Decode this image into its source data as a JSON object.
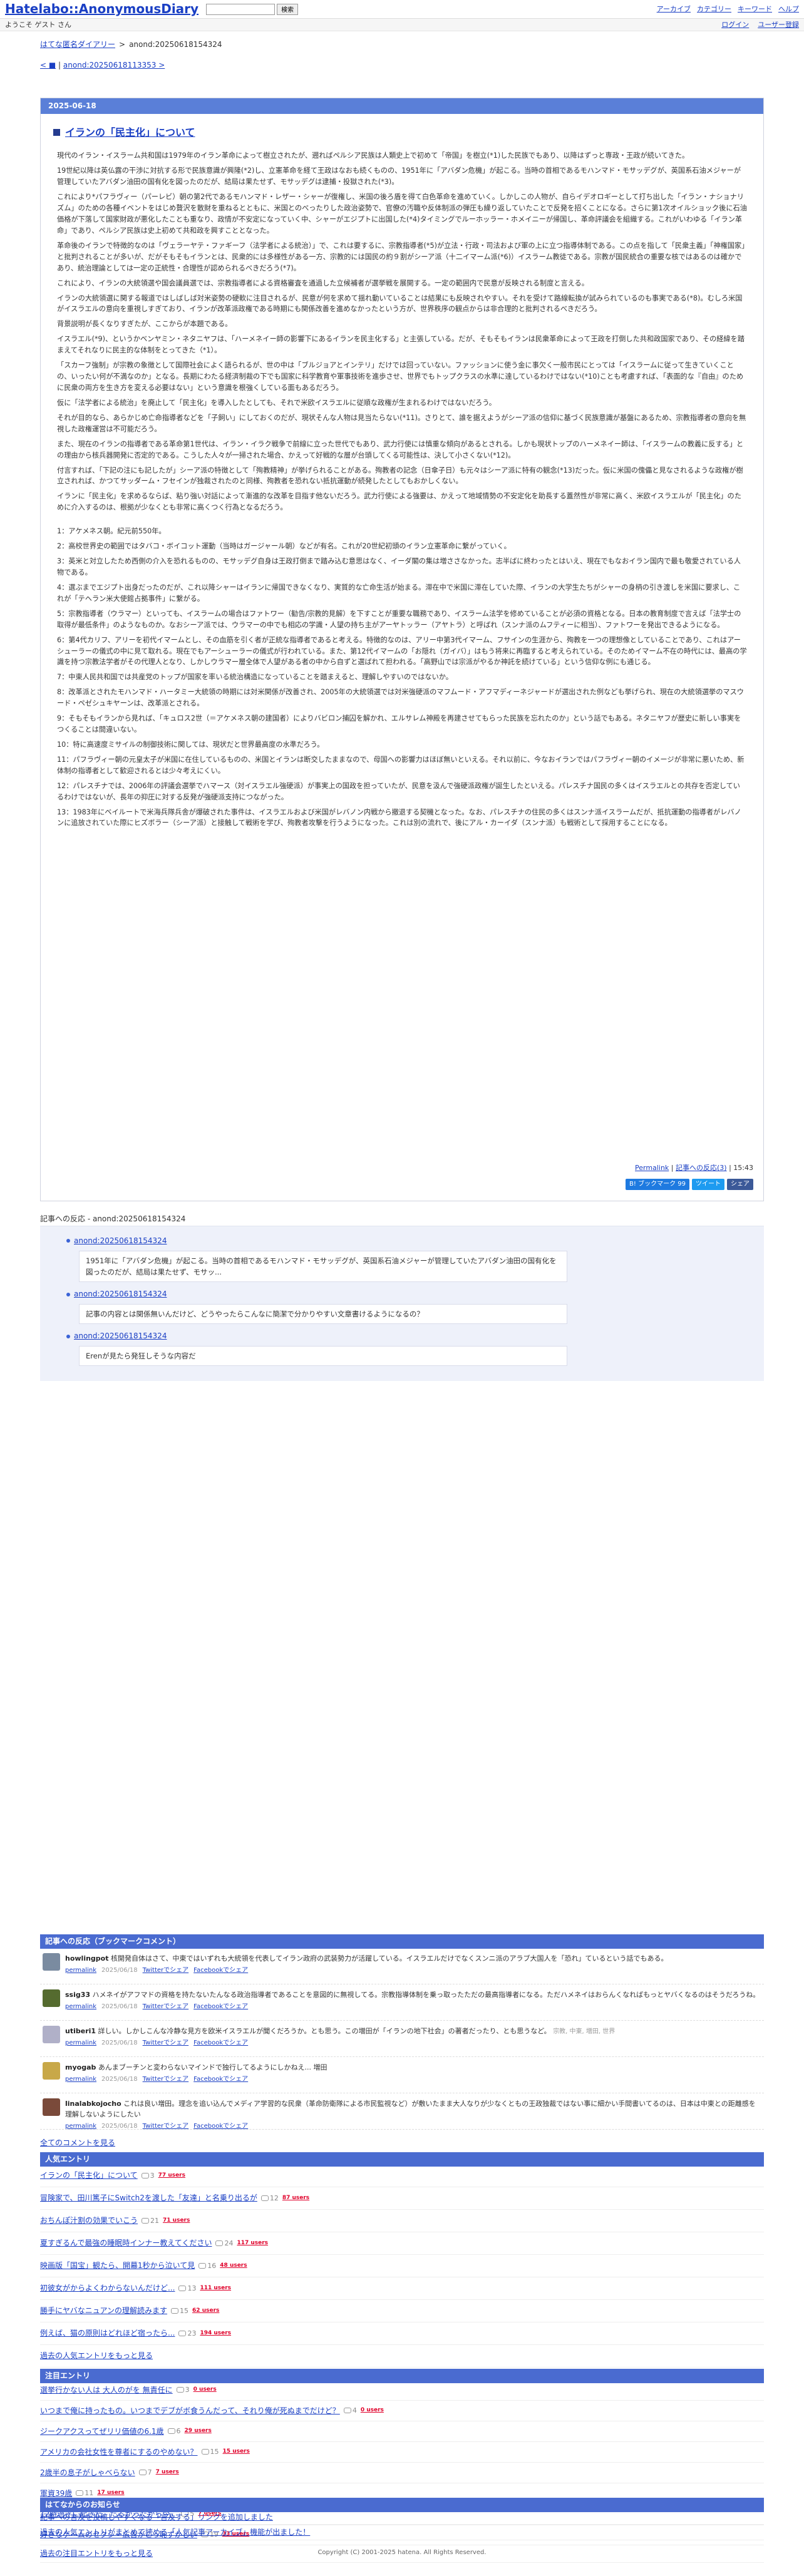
{
  "header": {
    "logo": "Hatelabo::AnonymousDiary",
    "search_button": "検索",
    "links": [
      "アーカイブ",
      "カテゴリー",
      "キーワード",
      "ヘルプ"
    ],
    "welcome": "ようこそ ゲスト さん",
    "login": "ログイン",
    "register": "ユーザー登録"
  },
  "breadcrumb": {
    "home": "はてな匿名ダイアリー",
    "sep": ">",
    "current": "anond:20250618154324"
  },
  "prevnext": {
    "prev": "< ■",
    "sep": "|",
    "next": "anond:20250618113353 >"
  },
  "article": {
    "date": "2025-06-18",
    "title": "イランの「民主化」について",
    "paragraphs": [
      "現代のイラン・イスラーム共和国は1979年のイラン革命によって樹立されたが、遡ればペルシア民族は人類史上で初めて「帝国」を樹立(*1)した民族でもあり、以降はずっと専政・王政が続いてきた。",
      "19世紀以降は英仏露の干渉に対抗する形で民族意識が興隆(*2)し、立憲革命を経て王政はなおも続くものの、1951年に「アバダン危機」が起こる。当時の首相であるモハンマド・モサッデグが、英国系石油メジャーが管理していたアバダン油田の国有化を図ったのだが、結局は果たせず、モサッデグは逮捕・投獄された(*3)。",
      "これにより*パフラヴィー（パーレビ）朝の第2代であるモハンマド・レザー・シャーが復権し、米国の後ろ盾を得て白色革命を進めていく。しかしこの人物が、自らイデオロギーとして打ち出した「イラン・ナショナリズム」のための各種イベントをはじめ贅沢を散財を重ねるとともに、米国とのべったりした政治姿勢で、官僚の汚職や反体制派の弾圧も繰り返していたことで反発を招くことになる。さらに第1次オイルショック後に石油価格が下落して国家財政が悪化したことも重なり、政情が不安定になっていく中、シャーがエジプトに出国した(*4)タイミングでルーホッラー・ホメイニーが帰国し、革命評議会を組織する。これがいわゆる「イラン革命」であり、ペルシア民族は史上初めて共和政を興すこととなった。",
      "革命後のイランで特徴的なのは「ヴェラーヤテ・ファギーフ（法学者による統治）」で、これは要するに、宗教指導者(*5)が立法・行政・司法および軍の上に立つ指導体制である。この点を指して「民衆主義」「神権国家」と批判されることが多いが、だがそもそもイランとは、民衆的には多様性がある一方、宗教的には国民の約９割がシーア派（十二イマーム派(*6)）イスラーム教徒である。宗教が国民統合の重要な核ではあるのは確かであり、統治理論としては一定の正統性・合理性が認められるべきだろう(*7)。",
      "これにより、イランの大統領選や国会議員選では、宗教指導者による資格審査を通過した立候補者が選挙戦を展開する。一定の範囲内で民意が反映される制度と言える。",
      "イランの大統領選に関する報道ではしばしば対米姿勢の硬軟に注目されるが、民意が何を求めて揺れ動いていることは結果にも反映されやすい。それを受けて路線転換が試みられているのも事実である(*8)。むしろ米国がイスラエルの意向を重視しすぎており、イランが改革派政権である時期にも関係改善を進めなかったという方が、世界秩序の観点からは非合理的と批判されるべきだろう。",
      "背景説明が長くなりすぎたが、ここからが本題である。",
      "イスラエル(*9)、というかベンヤミン・ネタニヤフは、「ハーメネイー師の影響下にあるイランを民主化する」と主張している。だが、そもそもイランは民衆革命によって王政を打倒した共和政国家であり、その経緯を踏まえてそれなりに民主的な体制をとってきた（*1）。",
      "「スカーフ強制」が宗教の象徴として国際社会によく語られるが、世の中は「ブルジョアとインテリ」だけでは回っていない。ファッションに使う金に事欠く一般市民にとっては「イスラームに従って生きていくことの、いったい何が不満なのか」となる。長期にわたる経済制裁の下でも国家に科学教育や軍事技術を進歩させ、世界でもトップクラスの水準に達しているわけではない(*10)ことも考慮すれば、「表面的な『自由』のために民衆の両方を生き方を変える必要はない」という意識を根強くしている面もあるだろう。",
      "仮に「法学者による統治」を廃止して「民主化」を導入したとしても、それで米欧イスラエルに従順な政権が生まれるわけではないだろう。",
      "それが目的なら、あらかじめ亡命指導者などを「子飼い」にしておくのだが、現状そんな人物は見当たらない(*11)。さりとて、誰を据えようがシーア派の信仰に基づく民族意識が基盤にあるため、宗教指導者の意向を無視した政権運営は不可能だろう。",
      "また、現在のイランの指導者である革命第1世代は、イラン・イラク戦争で前線に立った世代でもあり、武力行使には慎重な傾向があるとされる。しかも現状トップのハーメネイー師は、「イスラームの教義に反する」との理由から核兵器開発に否定的である。こうした人々が一掃された場合、かえって好戦的な層が台頭してくる可能性は、決して小さくない(*12)。",
      "付言すれば、「下記の注にも記したが」シーア派の特徴として「殉教精神」が挙げられることがある。殉教者の記念（日傘子日）も元々はシーア派に特有の観念(*13)だった。仮に米国の傀儡と見なされるような政権が樹立されれば、かつてサッダーム・フセインが独裁されたのと同様、殉教者を恐れない抵抗運動が続発したとしてもおかしくない。",
      "イランに「民主化」を求めるならば、粘り強い対話によって漸進的な改革を目指す他ないだろう。武力行使による強要は、かえって地域情勢の不安定化を助長する蓋然性が非常に高く、米欧イスラエルが「民主化」のために介入するのは、根拠が少なくとも非常に高くつく行為となるだろう。"
    ],
    "notes": [
      "1：アケメネス朝。紀元前550年。",
      "2：高校世界史の範囲ではタバコ・ボイコット運動（当時はガージャール朝）などが有名。これが20世紀初頭のイラン立憲革命に繋がっていく。",
      "3：英米と対立したため西側の介入を恐れるものの、モサッデグ自身は王政打倒まで踏み込む意思はなく、イーダ閣の集は増ささなかった。志半ばに終わったとはいえ、現在でもなおイラン国内で最も敬愛されている人物である。",
      "4：選ぶまでエジプト出身だったのだが、これ以降シャーはイランに帰国できなくなり、実質的な亡命生活が始まる。滞在中で米国に滞在していた際、イランの大学生たちがシャーの身柄の引き渡しを米国に要求し、これが「テヘラン米大使館占拠事件」に繋がる。",
      "5：宗教指導者（ウラマー）といっても、イスラームの場合はファトワー（勧告/宗教的見解）を下すことが重要な職務であり、イスラーム法学を修めていることが必須の資格となる。日本の教育制度で言えば「法学士の取得が最低条件」のようなものか。なおシーア派では、ウラマーの中でも相応の学識・人望の持ち主がアーヤトッラー（アヤトラ）と呼ばれ（スンナ派のムフティーに相当）、ファトワーを発出できるようになる。",
      "6：第4代カリフ、アリーを初代イマームとし、その血筋を引く者が正統な指導者であると考える。特徴的なのは、アリー中第3代イマーム、フサインの生涯から、殉教を一つの理想像としていることであり、これはアーシューラーの儀式の中に見て取れる。現在でもアーシューラーの儀式が行われている。また、第12代イマームの「お隠れ（ガイバ）」はもう将来に再臨すると考えられている。そのためイマーム不在の時代には、最高の学識を持つ宗教法学者がその代理人となり、しかしウラマー層全体で人望がある者の中から自ずと選ばれて担われる。「高野山では宗派がやるか神託を続けている」という信仰な例にも通じる。",
      "7：中東人民共和国では共産党のトップが国家を率いる統治構造になっていることを踏まえると、理解しやすいのではないか。",
      "8：改革派とされたモハンマド・ハータミー大統領の時期には対米関係が改善され、2005年の大統領選では対米強硬派のマフムード・アフマディーネジャードが選出された例なども挙げられ、現在の大統領選挙のマスウード・ペゼシュキヤーンは、改革派とされる。",
      "9：そもそもイランから見れば、「キュロス2世（＝アケメネス朝の建国者）によりバビロン捕囚を解かれ、エルサレム神殿を再建させてもらった民族を忘れたのか」という話でもある。ネタニヤフが歴史に新しい事実をつくることは間違いない。",
      "10：特に高速度ミサイルの制御技術に関しては、現状だと世界最高度の水準だろう。",
      "11：パフラヴィー朝の元皇太子が米国に在住しているものの、米国とイランは断交したままなので、母国への影響力はほぼ無いといえる。それ以前に、今なおイランではパフラヴィー朝のイメージが非常に悪いため、新体制の指導者として歓迎されるとは少々考えにくい。",
      "12：パレスチナでは、2006年の評議会選挙でハマース（対イスラエル強硬派）が事実上の国政を担っていたが、民意を汲んで強硬派政権が誕生したといえる。パレスチナ国民の多くはイスラエルとの共存を否定しているわけではないが、長年の抑圧に対する反発が強硬派支持につながった。",
      "13：1983年にベイルートで米海兵隊兵舎が爆破された事件は、イスラエルおよび米国がレバノン内戦から撤退する契機となった。なお、パレスチナの住民の多くはスンナ派イスラームだが、抵抗運動の指導者がレバノンに追放されていた際にヒズボラー（シーア派）と接触して戦術を学び、殉教者攻撃を行うようになった。これは別の流れで、後にアル・カーイダ（スンナ派）も戦術として採用することになる。"
    ],
    "permalink": "Permalink",
    "react_count": "記事への反応(3)",
    "time": "15:43",
    "share": {
      "bookmark": "B! ブックマーク 99",
      "tweet": "ツイート",
      "facebook": "シェア"
    }
  },
  "reactions": {
    "heading": "記事への反応 - anond:20250618154324",
    "items": [
      {
        "id": "anond:20250618154324",
        "text": "1951年に「アバダン危機」が起こる。当時の首相であるモハンマド・モサッデグが、英国系石油メジャーが管理していたアバダン油田の国有化を図ったのだが、結局は果たせず、モサッ..."
      },
      {
        "id": "anond:20250618154324",
        "text": "記事の内容とは関係無いんだけど、どうやったらこんなに簡潔で分かりやすい文章書けるようになるの？"
      },
      {
        "id": "anond:20250618154324",
        "text": "Erenが見たら発狂しそうな内容だ"
      }
    ]
  },
  "bookmarks": {
    "heading": "記事への反応（ブックマークコメント）",
    "items": [
      {
        "user": "howlingpot",
        "comment": "核開発自体はさて、中東ではいずれも大統領を代表してイラン政府の武装勢力が活躍している。イスラエルだけでなくスンニ派のアラブ大国人を「恐れ」ているという話でもある。",
        "date": "2025/06/18",
        "links": [
          "permalink",
          "Twitterでシェア",
          "Facebookでシェア"
        ],
        "tags": "",
        "color": "#7a8ba0"
      },
      {
        "user": "ssig33",
        "comment": "ハメネイがアフマドの資格を持たないたんなる政治指導者であることを意図的に無視してる。宗教指導体制を乗っ取ったただの最高指導者になる。ただハメネイはおらんくなればもっとヤバくなるのはそうだろうね。",
        "date": "2025/06/18",
        "links": [
          "permalink",
          "Twitterでシェア",
          "Facebookでシェア"
        ],
        "tags": "",
        "color": "#556b2f"
      },
      {
        "user": "utiberi1",
        "comment": "詳しい。しかしこんな冷静な見方を欧米イスラエルが聞くだろうか。とも思う。この増田が「イランの地下社会」の著者だったり、とも思うなど。",
        "date": "2025/06/18",
        "links": [
          "permalink",
          "Twitterでシェア",
          "Facebookでシェア"
        ],
        "tags": "宗教, 中東, 増田, 世界",
        "color": "#b0b0c8"
      },
      {
        "user": "myogab",
        "comment": "あんまブーチンと変わらないマインドで独行してるようにしかねえ... 増田",
        "date": "2025/06/18",
        "links": [
          "permalink",
          "Twitterでシェア",
          "Facebookでシェア"
        ],
        "tags": "",
        "color": "#c8a848"
      },
      {
        "user": "linalabkojocho",
        "comment": "これは良い増田。理念を追い込んでメディア学習的な民衆（革命防衛隊による市民監視など）が敷いたまま大人なりが少なくともの王政独裁ではない事に細かい手間書いてるのは、日本は中東との距離感を理解しないようにしたい",
        "date": "2025/06/18",
        "links": [
          "permalink",
          "Twitterでシェア",
          "Facebookでシェア"
        ],
        "tags": "",
        "color": "#7a4a3a"
      }
    ]
  },
  "all_comments": "全てのコメントを見る",
  "popular": {
    "heading": "人気エントリ",
    "items": [
      {
        "title": "イランの「民主化」について",
        "count": "3",
        "users": "77 users"
      },
      {
        "title": "冒険家で、田川篤子にSwitch2を渡した「友達」と名乗り出るが",
        "count": "12",
        "users": "87 users"
      },
      {
        "title": "おちんぽ汁割の効果でいこう",
        "count": "21",
        "users": "71 users"
      },
      {
        "title": "夏すぎるんで最強の睡眠時インナー教えてください",
        "count": "24",
        "users": "117 users"
      },
      {
        "title": "映画版「国宝」観たら、開幕1秒から泣いて見",
        "count": "16",
        "users": "48 users"
      },
      {
        "title": "初彼女がからよくわからないんだけど...",
        "count": "13",
        "users": "111 users"
      },
      {
        "title": "勝手にヤバなニュアンの理解読みます",
        "count": "15",
        "users": "62 users"
      },
      {
        "title": "例えば、猫の原則はどれほど宿ったら...",
        "count": "23",
        "users": "194 users"
      }
    ],
    "more": "過去の人気エントリをもっと見る"
  },
  "attention": {
    "heading": "注目エントリ",
    "items": [
      {
        "title": "選挙行かない人は 大人のがを 無責任に",
        "count": "3",
        "users": "0 users"
      },
      {
        "title": "いつまで俺に持ったもの。いつまでデブがボ食うんだって、それり俺が死ぬまでだけど？",
        "count": "4",
        "users": "0 users"
      },
      {
        "title": "ジークアクスってぜリリ価値の6.1歳",
        "count": "6",
        "users": "29 users"
      },
      {
        "title": "アメリカの会社女性を尊者にするのやめない？",
        "count": "15",
        "users": "15 users"
      },
      {
        "title": "2歳半の息子がしゃべらない",
        "count": "7",
        "users": "7 users"
      },
      {
        "title": "軍資39歳",
        "count": "11",
        "users": "17 users"
      },
      {
        "title": "12時過ぎに起きた。だるかったから今。",
        "count": "5",
        "users": "7 users"
      },
      {
        "title": "好きなゲームのセクシー広告がこっ恥ずかしい",
        "count": "19",
        "users": "33 users"
      }
    ],
    "more": "過去の注目エントリをもっと見る"
  },
  "news": {
    "heading": "はてなからのお知らせ",
    "items": [
      "記事への言及を投稿しやすくなる「言及する」リンクを追加しました",
      "過去の人気エントリがまとめて読める「人気記事アーカイブ」機能が出ました！"
    ]
  },
  "footer": "Copyright (C) 2001-2025 hatena. All Rights Reserved."
}
